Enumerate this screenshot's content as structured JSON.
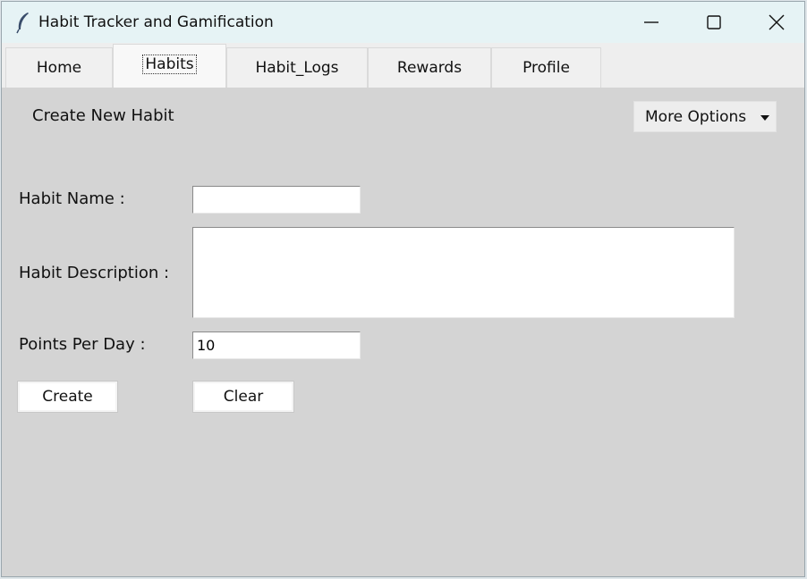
{
  "window": {
    "title": "Habit Tracker and Gamification",
    "icons": {
      "app": "feather-icon",
      "minimize": "minimize-icon",
      "maximize": "maximize-icon",
      "close": "close-icon"
    }
  },
  "tabs": [
    {
      "label": "Home",
      "active": false
    },
    {
      "label": "Habits",
      "active": true
    },
    {
      "label": "Habit_Logs",
      "active": false
    },
    {
      "label": "Rewards",
      "active": false
    },
    {
      "label": "Profile",
      "active": false
    }
  ],
  "form": {
    "heading": "Create New Habit",
    "more_options": {
      "label": "More Options",
      "icon": "dropdown-arrow-icon"
    },
    "habit_name": {
      "label": "Habit Name :",
      "value": ""
    },
    "habit_description": {
      "label": "Habit Description :",
      "value": ""
    },
    "points_per_day": {
      "label": "Points Per Day :",
      "value": "10"
    },
    "create_label": "Create",
    "clear_label": "Clear"
  },
  "colors": {
    "titlebar": "#e6f3f5",
    "background": "#d4d4d4",
    "tabbar": "#eeeeee"
  }
}
